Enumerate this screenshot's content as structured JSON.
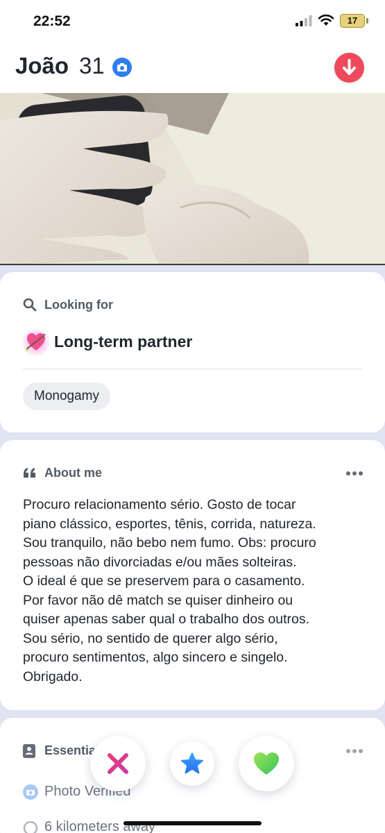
{
  "status_bar": {
    "time": "22:52",
    "battery_level": "17"
  },
  "header": {
    "name": "João",
    "age": "31"
  },
  "looking_for": {
    "heading": "Looking for",
    "value": "Long-term partner",
    "emoji": "heart-with-arrow-icon",
    "chips": [
      "Monogamy"
    ]
  },
  "about": {
    "heading": "About me",
    "text": "Procuro relacionamento sério. Gosto de tocar\npiano clássico, esportes, tênis, corrida, natureza.\nSou tranquilo, não bebo nem fumo. Obs: procuro\npessoas não divorciadas e/ou mães solteiras.\nO ideal é que se preservem para o casamento.\nPor favor não dê match se quiser dinheiro ou\nquiser apenas saber qual o trabalho dos outros.\n  Sou sério, no sentido de querer algo sério,\nprocuro sentimentos, algo sincero e singelo.\nObrigado."
  },
  "essentials": {
    "heading": "Essentials",
    "items": [
      "Photo Verified",
      "6 kilometers away"
    ]
  },
  "actions": {
    "nope": "close-icon",
    "super_like": "star-icon",
    "like": "heart-icon"
  },
  "colors": {
    "accent_red": "#ee4a5d",
    "verified_blue": "#2e7ff0",
    "nope_pink": "#e8368f",
    "like_green": "#5fd45a",
    "star_blue": "#2f8cf3",
    "page_bg": "#dfe3f2"
  }
}
